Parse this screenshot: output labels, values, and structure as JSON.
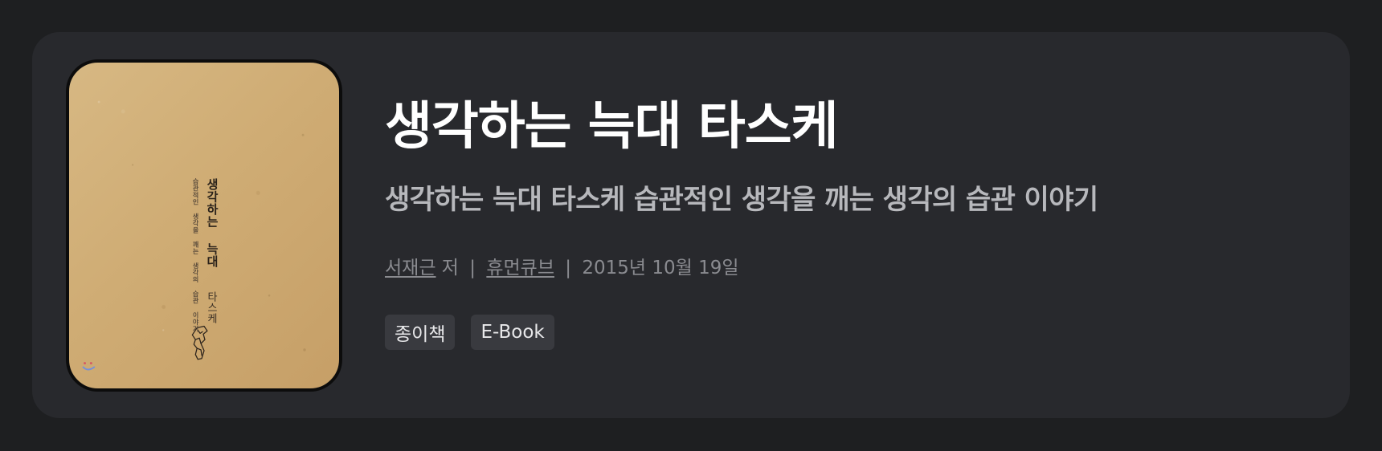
{
  "book": {
    "title": "생각하는 늑대 타스케",
    "subtitle": "생각하는 늑대 타스케 습관적인 생각을 깨는 생각의 습관 이야기",
    "author_link": "서재근",
    "author_suffix": "저",
    "separator_1": "|",
    "publisher_link": "휴먼큐브",
    "separator_2": "|",
    "published_date": "2015년 10월 19일",
    "formats": [
      "종이책",
      "E-Book"
    ]
  },
  "cover": {
    "title_vertical": "생각하는 늑대",
    "subtitle_vertical": "습관적인 생각을 깨는 생각의 습관 이야기",
    "series_vertical": "타스케",
    "icon": "wolf-illustration-icon",
    "smile_icon": "smile-icon"
  },
  "colors": {
    "page_background": "#1e1f21",
    "card_background": "#28292d",
    "title": "#ffffff",
    "subtitle": "#b7b8bc",
    "meta": "#8a8b90",
    "tag_background": "#393a3f",
    "tag_text": "#e8e8ea"
  }
}
